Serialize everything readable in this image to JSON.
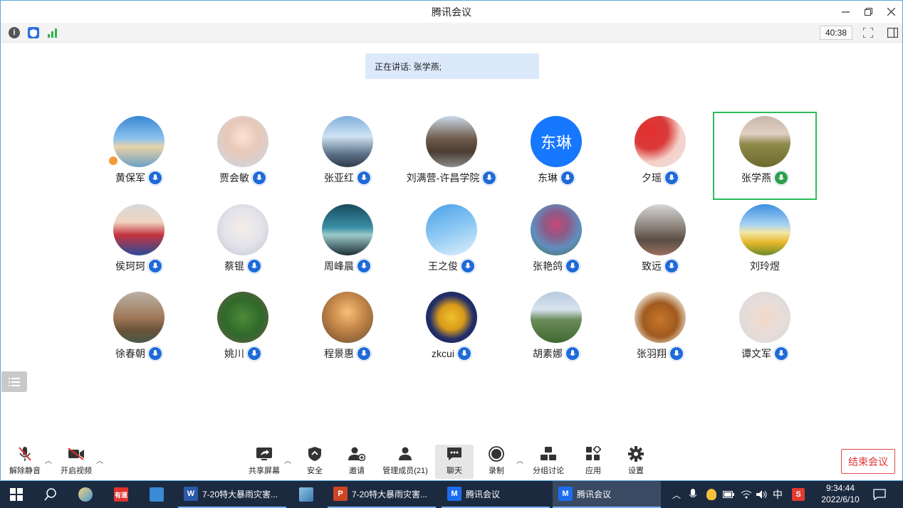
{
  "window": {
    "title": "腾讯会议"
  },
  "topbar": {
    "timer": "40:38"
  },
  "speaking_banner": "正在讲话: 张学燕;",
  "participants": [
    {
      "name": "黄保军"
    },
    {
      "name": "贾会敏"
    },
    {
      "name": "张亚红"
    },
    {
      "name": "刘满营-许昌学院"
    },
    {
      "name": "东琳",
      "avatar_text": "东琳"
    },
    {
      "name": "夕瑶"
    },
    {
      "name": "张学燕"
    },
    {
      "name": "侯珂珂"
    },
    {
      "name": "蔡锟"
    },
    {
      "name": "周峰晨"
    },
    {
      "name": "王之俊"
    },
    {
      "name": "张艳鸽"
    },
    {
      "name": "致远"
    },
    {
      "name": "刘玲煜"
    },
    {
      "name": "徐春朝"
    },
    {
      "name": "姚川"
    },
    {
      "name": "程景惠"
    },
    {
      "name": "zkcui"
    },
    {
      "name": "胡素娜"
    },
    {
      "name": "张羽翔"
    },
    {
      "name": "谭文军"
    }
  ],
  "toolbar": {
    "unmute": "解除静音",
    "start_video": "开启视频",
    "share_screen": "共享屏幕",
    "security": "安全",
    "invite": "邀请",
    "manage_members": "管理成员(21)",
    "chat": "聊天",
    "record": "录制",
    "breakout": "分组讨论",
    "apps": "应用",
    "settings": "设置",
    "end_meeting": "结束会议"
  },
  "taskbar": {
    "word_task": "7-20特大暴雨灾害...",
    "ppt_task": "7-20特大暴雨灾害...",
    "meeting_task_1": "腾讯会议",
    "meeting_task_2": "腾讯会议",
    "ime": "中",
    "time": "9:34:44",
    "date": "2022/6/10"
  },
  "colors": {
    "accent_blue": "#1f6ad8",
    "active_speaker_green": "#2fba5c",
    "end_red": "#e14a4a",
    "taskbar": "#1c2a40"
  }
}
